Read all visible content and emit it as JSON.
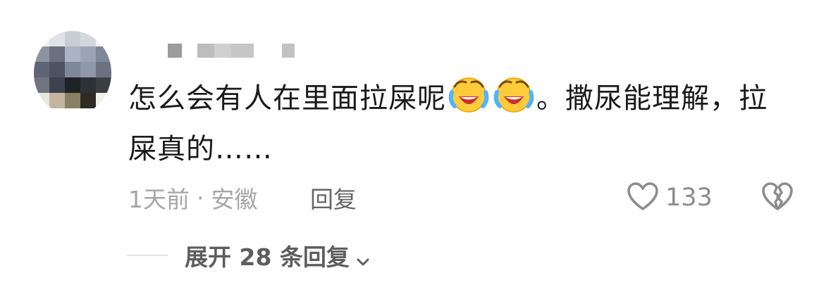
{
  "comment": {
    "text_before_emoji": "怎么会有人在里面拉屎呢",
    "emoji_name": "laughing-crying-face",
    "text_after_emoji": "。撒尿能理解，拉屎真的……",
    "time": "1天前",
    "separator": "·",
    "location": "安徽",
    "reply_label": "回复",
    "like_count": "133",
    "expand_label": "展开 28 条回复"
  },
  "colors": {
    "text": "#1a1a1a",
    "meta": "#a6a6a6",
    "reply": "#666666",
    "icon": "#8c8c8c",
    "expand": "#5e5e5e",
    "emoji_face": "#ffcb3b",
    "emoji_tears": "#4fb3ff"
  }
}
